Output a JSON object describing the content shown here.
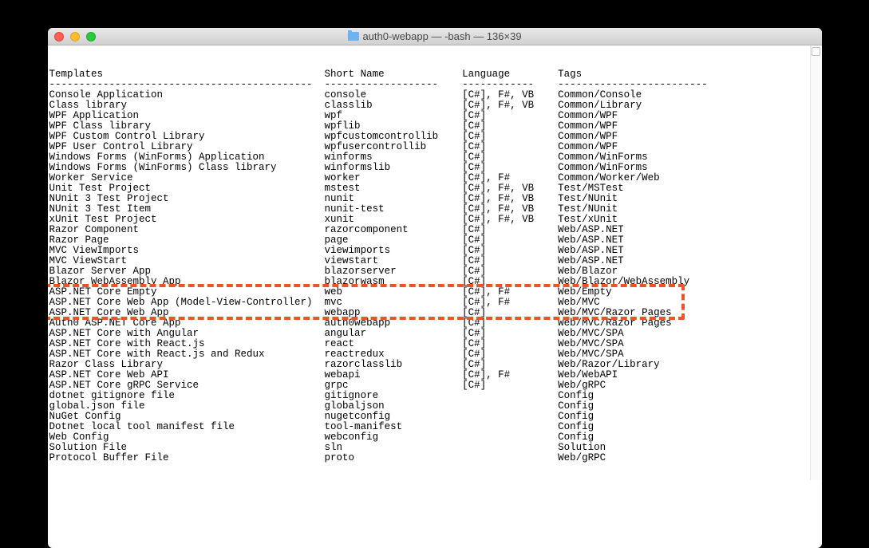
{
  "window": {
    "title": "auth0-webapp — -bash — 136×39"
  },
  "headers": {
    "templates": "Templates",
    "shortName": "Short Name",
    "language": "Language",
    "tags": "Tags"
  },
  "separator": {
    "templates": "--------------------------------------------",
    "shortName": "-------------------",
    "language": "------------",
    "tags": "-------------------------"
  },
  "rows": [
    {
      "t": "Console Application",
      "s": "console",
      "l": "[C#], F#, VB",
      "g": "Common/Console"
    },
    {
      "t": "Class library",
      "s": "classlib",
      "l": "[C#], F#, VB",
      "g": "Common/Library"
    },
    {
      "t": "WPF Application",
      "s": "wpf",
      "l": "[C#]",
      "g": "Common/WPF"
    },
    {
      "t": "WPF Class library",
      "s": "wpflib",
      "l": "[C#]",
      "g": "Common/WPF"
    },
    {
      "t": "WPF Custom Control Library",
      "s": "wpfcustomcontrollib",
      "l": "[C#]",
      "g": "Common/WPF"
    },
    {
      "t": "WPF User Control Library",
      "s": "wpfusercontrollib",
      "l": "[C#]",
      "g": "Common/WPF"
    },
    {
      "t": "Windows Forms (WinForms) Application",
      "s": "winforms",
      "l": "[C#]",
      "g": "Common/WinForms"
    },
    {
      "t": "Windows Forms (WinForms) Class library",
      "s": "winformslib",
      "l": "[C#]",
      "g": "Common/WinForms"
    },
    {
      "t": "Worker Service",
      "s": "worker",
      "l": "[C#], F#",
      "g": "Common/Worker/Web"
    },
    {
      "t": "Unit Test Project",
      "s": "mstest",
      "l": "[C#], F#, VB",
      "g": "Test/MSTest"
    },
    {
      "t": "NUnit 3 Test Project",
      "s": "nunit",
      "l": "[C#], F#, VB",
      "g": "Test/NUnit"
    },
    {
      "t": "NUnit 3 Test Item",
      "s": "nunit-test",
      "l": "[C#], F#, VB",
      "g": "Test/NUnit"
    },
    {
      "t": "xUnit Test Project",
      "s": "xunit",
      "l": "[C#], F#, VB",
      "g": "Test/xUnit"
    },
    {
      "t": "Razor Component",
      "s": "razorcomponent",
      "l": "[C#]",
      "g": "Web/ASP.NET"
    },
    {
      "t": "Razor Page",
      "s": "page",
      "l": "[C#]",
      "g": "Web/ASP.NET"
    },
    {
      "t": "MVC ViewImports",
      "s": "viewimports",
      "l": "[C#]",
      "g": "Web/ASP.NET"
    },
    {
      "t": "MVC ViewStart",
      "s": "viewstart",
      "l": "[C#]",
      "g": "Web/ASP.NET"
    },
    {
      "t": "Blazor Server App",
      "s": "blazorserver",
      "l": "[C#]",
      "g": "Web/Blazor"
    },
    {
      "t": "Blazor WebAssembly App",
      "s": "blazorwasm",
      "l": "[C#]",
      "g": "Web/Blazor/WebAssembly"
    },
    {
      "t": "ASP.NET Core Empty",
      "s": "web",
      "l": "[C#], F#",
      "g": "Web/Empty"
    },
    {
      "t": "ASP.NET Core Web App (Model-View-Controller)",
      "s": "mvc",
      "l": "[C#], F#",
      "g": "Web/MVC"
    },
    {
      "t": "ASP.NET Core Web App",
      "s": "webapp",
      "l": "[C#]",
      "g": "Web/MVC/Razor Pages"
    },
    {
      "t": "Auth0 ASP.NET Core App",
      "s": "auth0webapp",
      "l": "[C#]",
      "g": "Web/MVC/Razor Pages"
    },
    {
      "t": "ASP.NET Core with Angular",
      "s": "angular",
      "l": "[C#]",
      "g": "Web/MVC/SPA"
    },
    {
      "t": "ASP.NET Core with React.js",
      "s": "react",
      "l": "[C#]",
      "g": "Web/MVC/SPA"
    },
    {
      "t": "ASP.NET Core with React.js and Redux",
      "s": "reactredux",
      "l": "[C#]",
      "g": "Web/MVC/SPA"
    },
    {
      "t": "Razor Class Library",
      "s": "razorclasslib",
      "l": "[C#]",
      "g": "Web/Razor/Library"
    },
    {
      "t": "ASP.NET Core Web API",
      "s": "webapi",
      "l": "[C#], F#",
      "g": "Web/WebAPI"
    },
    {
      "t": "ASP.NET Core gRPC Service",
      "s": "grpc",
      "l": "[C#]",
      "g": "Web/gRPC"
    },
    {
      "t": "dotnet gitignore file",
      "s": "gitignore",
      "l": "",
      "g": "Config"
    },
    {
      "t": "global.json file",
      "s": "globaljson",
      "l": "",
      "g": "Config"
    },
    {
      "t": "NuGet Config",
      "s": "nugetconfig",
      "l": "",
      "g": "Config"
    },
    {
      "t": "Dotnet local tool manifest file",
      "s": "tool-manifest",
      "l": "",
      "g": "Config"
    },
    {
      "t": "Web Config",
      "s": "webconfig",
      "l": "",
      "g": "Config"
    },
    {
      "t": "Solution File",
      "s": "sln",
      "l": "",
      "g": "Solution"
    },
    {
      "t": "Protocol Buffer File",
      "s": "proto",
      "l": "",
      "g": "Web/gRPC"
    }
  ],
  "columnWidths": {
    "t": 46,
    "s": 23,
    "l": 16
  },
  "highlight": {
    "startRow": 21,
    "endRow": 23
  }
}
